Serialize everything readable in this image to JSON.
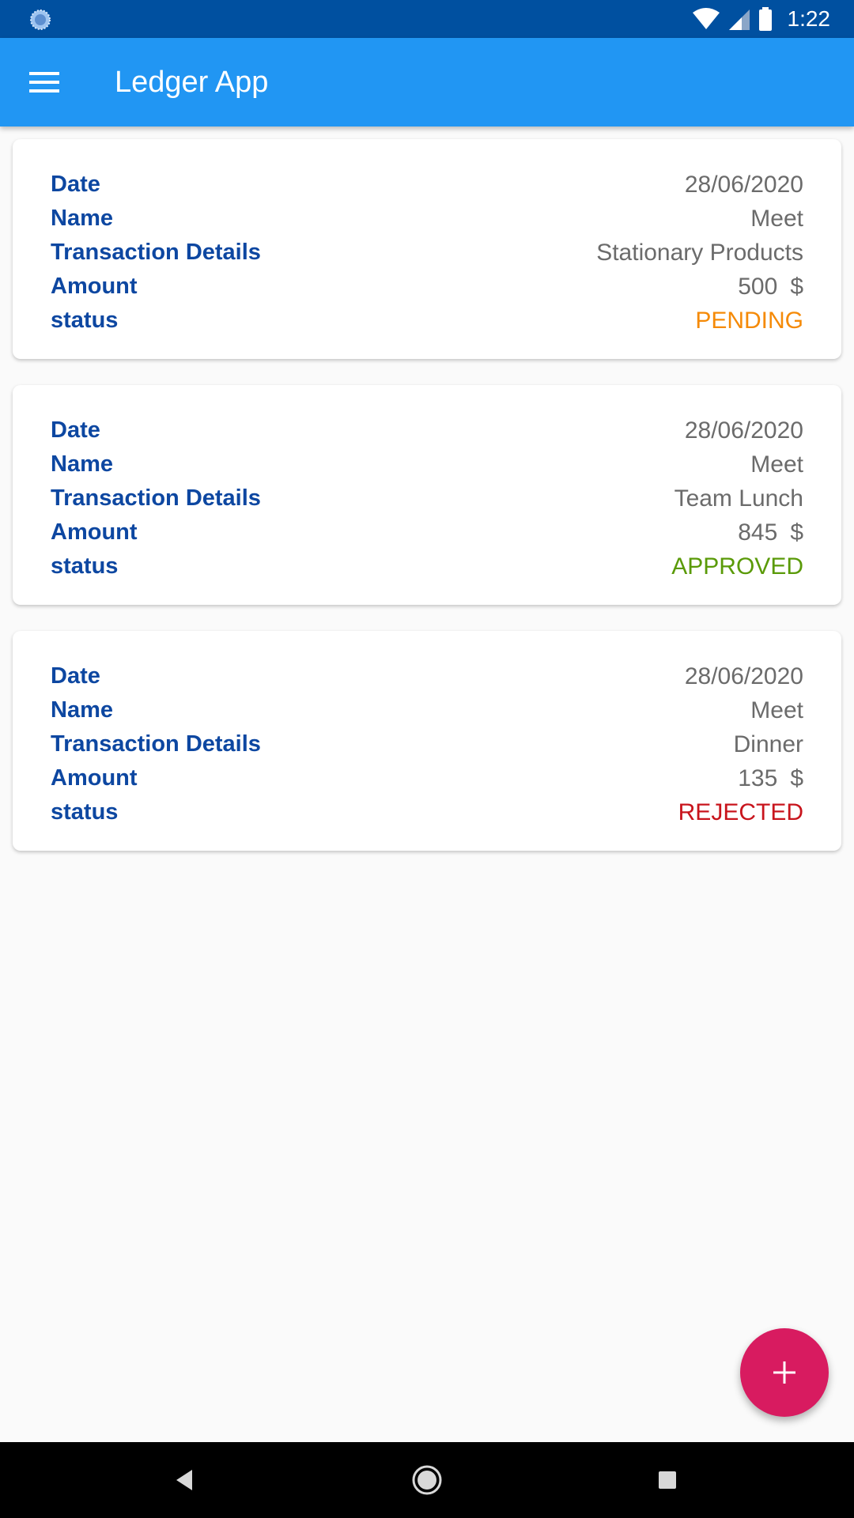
{
  "status_bar": {
    "time": "1:22"
  },
  "app_bar": {
    "title": "Ledger App"
  },
  "transactions": [
    {
      "date_label": "Date",
      "date": "28/06/2020",
      "name_label": "Name",
      "name": "Meet",
      "details_label": "Transaction Details",
      "details": "Stationary Products",
      "amount_label": "Amount",
      "amount": "500",
      "currency": "$",
      "status_label": "status",
      "status": "PENDING",
      "status_color": "#f58a07"
    },
    {
      "date_label": "Date",
      "date": "28/06/2020",
      "name_label": "Name",
      "name": "Meet",
      "details_label": "Transaction Details",
      "details": "Team Lunch",
      "amount_label": "Amount",
      "amount": "845",
      "currency": "$",
      "status_label": "status",
      "status": "APPROVED",
      "status_color": "#5a9a08"
    },
    {
      "date_label": "Date",
      "date": "28/06/2020",
      "name_label": "Name",
      "name": "Meet",
      "details_label": "Transaction Details",
      "details": "Dinner",
      "amount_label": "Amount",
      "amount": "135",
      "currency": "$",
      "status_label": "status",
      "status": "REJECTED",
      "status_color": "#c8141c"
    }
  ],
  "fab": {
    "icon": "plus-icon"
  },
  "colors": {
    "status_bar": "#0050a0",
    "app_bar": "#2196f3",
    "label": "#0d47a1",
    "fab": "#d81b60"
  }
}
